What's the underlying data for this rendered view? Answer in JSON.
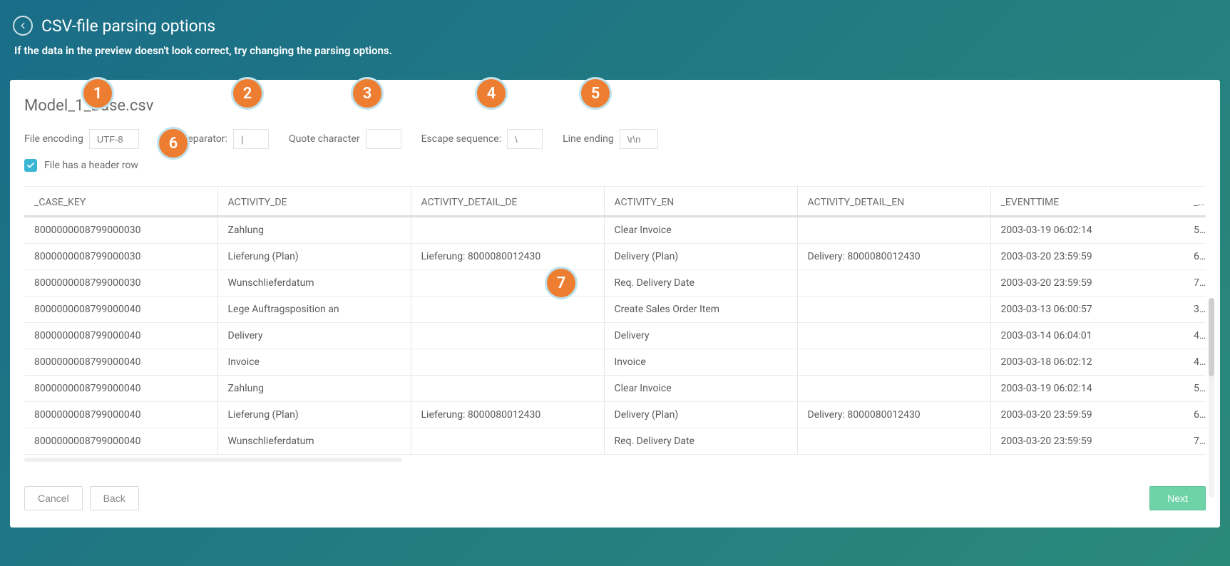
{
  "header": {
    "title": "CSV-file parsing options",
    "subtitle": "If the data in the preview doesn't look correct, try changing the parsing options."
  },
  "file": {
    "name": "Model_1_Base.csv"
  },
  "options": {
    "encoding_label": "File encoding",
    "encoding_value": "UTF-8",
    "separator_label": "Field separator:",
    "separator_value": "|",
    "quote_label": "Quote character",
    "quote_value": "",
    "escape_label": "Escape sequence:",
    "escape_value": "\\",
    "lineend_label": "Line ending",
    "lineend_value": "\\r\\n",
    "header_checkbox_label": "File has a header row",
    "header_checked": true
  },
  "columns": [
    "_CASE_KEY",
    "ACTIVITY_DE",
    "ACTIVITY_DETAIL_DE",
    "ACTIVITY_EN",
    "ACTIVITY_DETAIL_EN",
    "_EVENTTIME",
    "_S"
  ],
  "rows": [
    {
      "case": "8000000008799000030",
      "de": "Zahlung",
      "de_d": "",
      "en": "Clear Invoice",
      "en_d": "",
      "t": "2003-03-19 06:02:14",
      "s": "5"
    },
    {
      "case": "8000000008799000030",
      "de": "Lieferung (Plan)",
      "de_d": "Lieferung: 8000080012430",
      "en": "Delivery (Plan)",
      "en_d": "Delivery: 8000080012430",
      "t": "2003-03-20 23:59:59",
      "s": "6"
    },
    {
      "case": "8000000008799000030",
      "de": "Wunschlieferdatum",
      "de_d": "",
      "en": "Req. Delivery Date",
      "en_d": "",
      "t": "2003-03-20 23:59:59",
      "s": "7"
    },
    {
      "case": "8000000008799000040",
      "de": "Lege Auftragsposition an",
      "de_d": "",
      "en": "Create Sales Order Item",
      "en_d": "",
      "t": "2003-03-13 06:00:57",
      "s": "3"
    },
    {
      "case": "8000000008799000040",
      "de": "Delivery",
      "de_d": "",
      "en": "Delivery",
      "en_d": "",
      "t": "2003-03-14 06:04:01",
      "s": "4"
    },
    {
      "case": "8000000008799000040",
      "de": "Invoice",
      "de_d": "",
      "en": "Invoice",
      "en_d": "",
      "t": "2003-03-18 06:02:12",
      "s": "4"
    },
    {
      "case": "8000000008799000040",
      "de": "Zahlung",
      "de_d": "",
      "en": "Clear Invoice",
      "en_d": "",
      "t": "2003-03-19 06:02:14",
      "s": "5"
    },
    {
      "case": "8000000008799000040",
      "de": "Lieferung (Plan)",
      "de_d": "Lieferung: 8000080012430",
      "en": "Delivery (Plan)",
      "en_d": "Delivery: 8000080012430",
      "t": "2003-03-20 23:59:59",
      "s": "6"
    },
    {
      "case": "8000000008799000040",
      "de": "Wunschlieferdatum",
      "de_d": "",
      "en": "Req. Delivery Date",
      "en_d": "",
      "t": "2003-03-20 23:59:59",
      "s": "7"
    }
  ],
  "footer": {
    "cancel": "Cancel",
    "back": "Back",
    "next": "Next"
  },
  "callouts": [
    "1",
    "2",
    "3",
    "4",
    "5",
    "6",
    "7"
  ]
}
